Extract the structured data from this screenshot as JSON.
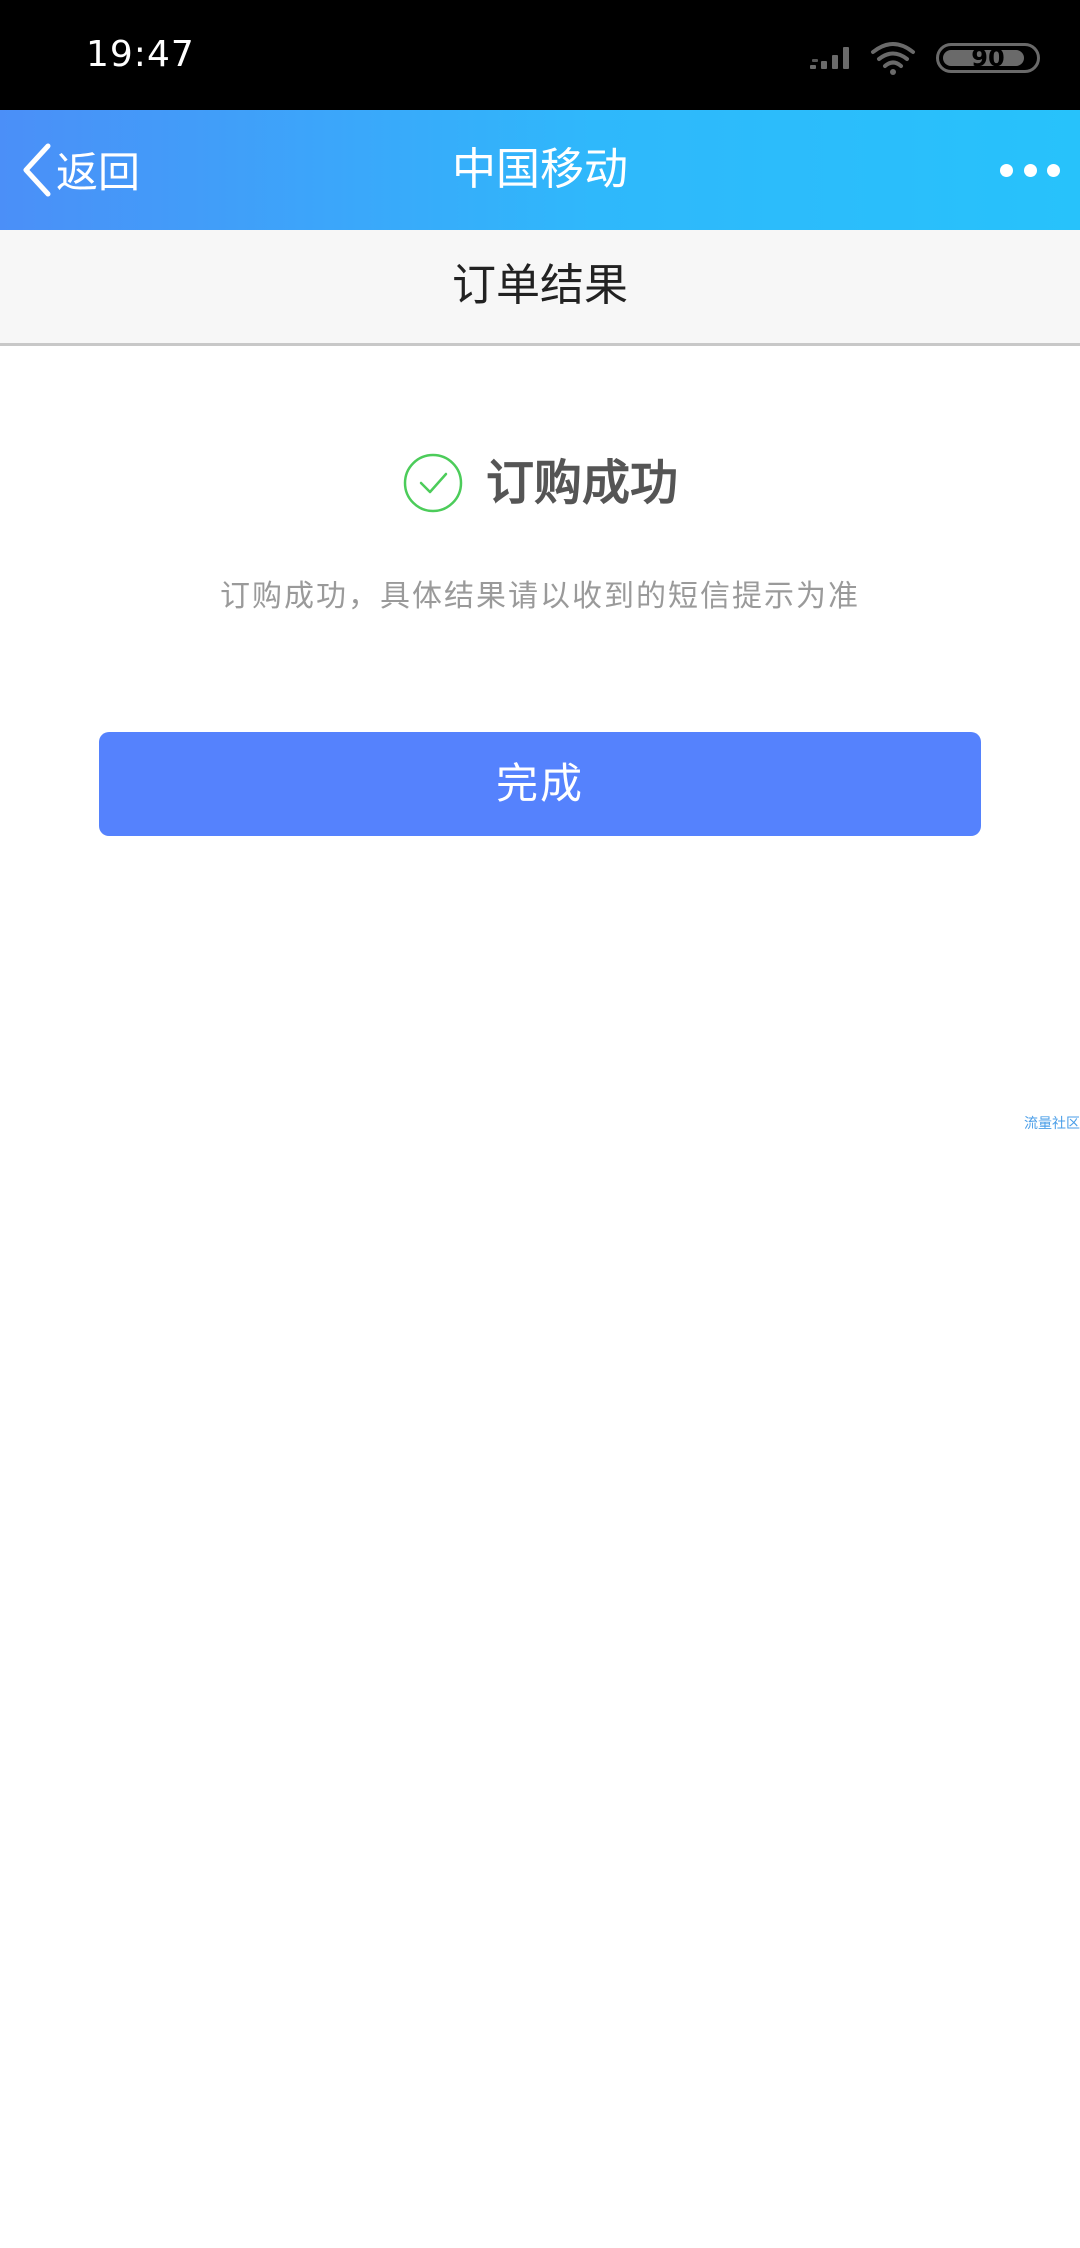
{
  "status_bar": {
    "time": "19:47",
    "battery": "90",
    "battery_level": 0.9
  },
  "header": {
    "back_label": "返回",
    "title": "中国移动"
  },
  "sub_header": {
    "title": "订单结果"
  },
  "result": {
    "title": "订购成功",
    "description": "订购成功，具体结果请以收到的短信提示为准"
  },
  "actions": {
    "done_label": "完成"
  },
  "watermark": "流量社区",
  "colors": {
    "header_gradient_start": "#4b8ff8",
    "header_gradient_end": "#27c2fb",
    "primary_button": "#5582fd",
    "success_check": "#4ccc5a"
  }
}
